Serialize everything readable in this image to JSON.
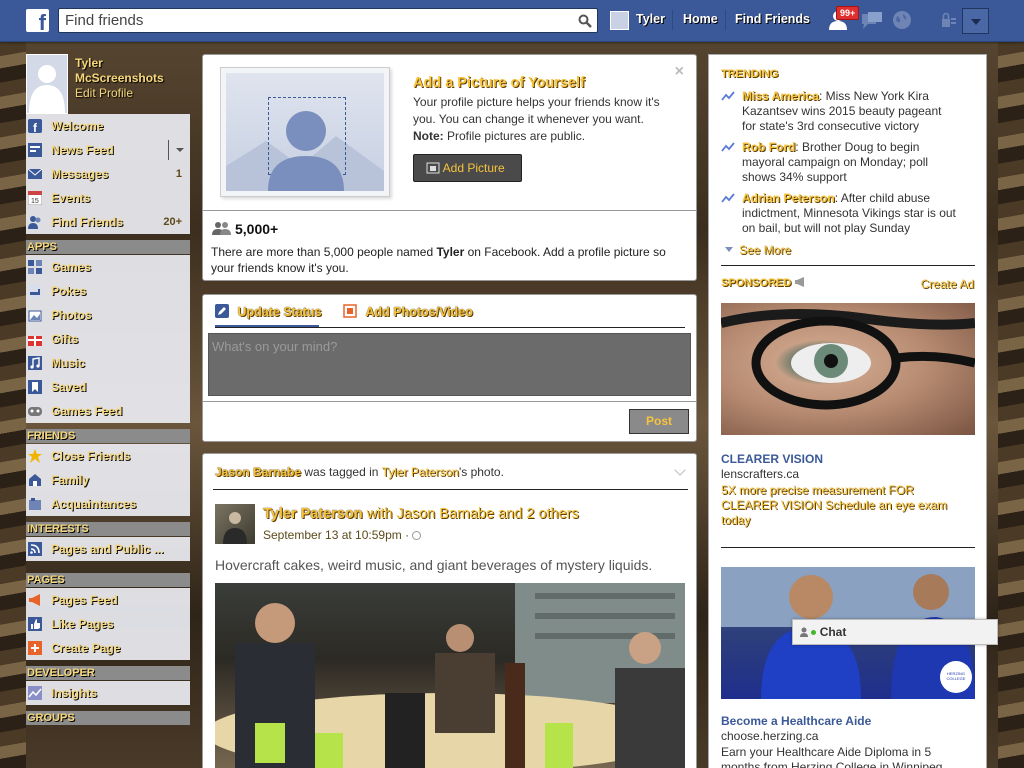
{
  "topbar": {
    "logo": "f",
    "search_placeholder": "Find friends",
    "user": "Tyler",
    "home": "Home",
    "find_friends": "Find Friends",
    "notif_count": "99+"
  },
  "profile": {
    "name": "Tyler McScreenshots",
    "edit": "Edit Profile"
  },
  "nav": {
    "main": [
      {
        "label": "Welcome",
        "count": "",
        "icon": "facebook-icon"
      },
      {
        "label": "News Feed",
        "count": "",
        "icon": "news-feed-icon"
      },
      {
        "label": "Messages",
        "count": "1",
        "icon": "messages-icon"
      },
      {
        "label": "Events",
        "count": "",
        "icon": "calendar-icon"
      },
      {
        "label": "Find Friends",
        "count": "20+",
        "icon": "find-friends-icon"
      }
    ],
    "apps_title": "APPS",
    "apps": [
      {
        "label": "Games",
        "icon": "games-icon"
      },
      {
        "label": "Pokes",
        "icon": "pokes-icon"
      },
      {
        "label": "Photos",
        "icon": "photos-icon"
      },
      {
        "label": "Gifts",
        "icon": "gifts-icon"
      },
      {
        "label": "Music",
        "icon": "music-icon"
      },
      {
        "label": "Saved",
        "icon": "saved-icon"
      },
      {
        "label": "Games Feed",
        "icon": "games-feed-icon"
      }
    ],
    "friends_title": "FRIENDS",
    "friends": [
      {
        "label": "Close Friends",
        "icon": "star-icon"
      },
      {
        "label": "Family",
        "icon": "family-icon"
      },
      {
        "label": "Acquaintances",
        "icon": "acquaintances-icon"
      }
    ],
    "interests_title": "INTERESTS",
    "interests": [
      {
        "label": "Pages and Public ...",
        "icon": "rss-icon"
      }
    ],
    "pages_title": "PAGES",
    "pages": [
      {
        "label": "Pages Feed",
        "icon": "megaphone-icon"
      },
      {
        "label": "Like Pages",
        "icon": "like-icon"
      },
      {
        "label": "Create Page",
        "icon": "plus-icon"
      }
    ],
    "developer_title": "DEVELOPER",
    "developer": [
      {
        "label": "Insights",
        "icon": "insights-icon"
      }
    ],
    "groups_title": "GROUPS"
  },
  "add_picture": {
    "title": "Add a Picture of Yourself",
    "body": "Your profile picture helps your friends know it's you. You can change it whenever you want.",
    "note_label": "Note:",
    "note": " Profile pictures are public.",
    "button": "Add Picture",
    "count": "5,000+",
    "desc_pre": "There are more than 5,000 people named ",
    "desc_name": "Tyler",
    "desc_post": " on Facebook. Add a profile picture so your friends know it's you."
  },
  "composer": {
    "tab_status": "Update Status",
    "tab_photo": "Add Photos/Video",
    "placeholder": "What's on your mind?",
    "post": "Post"
  },
  "story": {
    "tag_name": "Jason Barnabe",
    "tag_mid": " was tagged in ",
    "tag_owner": "Tyler Paterson",
    "tag_end": "'s photo.",
    "author": "Tyler Paterson",
    "with": " with ",
    "with_name": "Jason Barnabe",
    "and": " and ",
    "others": "2 others",
    "date": "September 13 at 10:59pm · ",
    "text": "Hovercraft cakes, weird music, and giant beverages of mystery liquids."
  },
  "trending": {
    "title": "TRENDING",
    "items": [
      {
        "topic": "Miss America",
        "text": ": Miss New York Kira Kazantsev wins 2015 beauty pageant for state's 3rd consecutive victory"
      },
      {
        "topic": "Rob Ford",
        "text": ": Brother Doug to begin mayoral campaign on Monday; poll shows 34% support"
      },
      {
        "topic": "Adrian Peterson",
        "text": ": After child abuse indictment, Minnesota Vikings star is out on bail, but will not play Sunday"
      }
    ],
    "see_more": "See More"
  },
  "sponsored": {
    "title": "SPONSORED",
    "create_ad": "Create Ad",
    "ads": [
      {
        "title": "CLEARER VISION",
        "domain": "lenscrafters.ca",
        "text": "5X more precise measurement FOR CLEARER VISION Schedule an eye exam today"
      },
      {
        "title": "Become a Healthcare Aide",
        "domain": "choose.herzing.ca",
        "text": "Earn your Healthcare Aide Diploma in 5 months from Herzing College in Winnipeg"
      }
    ],
    "herzing_badge": "HERZING COLLEGE"
  },
  "chat": {
    "label": "Chat"
  },
  "colors": {
    "fb_blue": "#3b5998",
    "gold_link": "#f6c33c"
  }
}
